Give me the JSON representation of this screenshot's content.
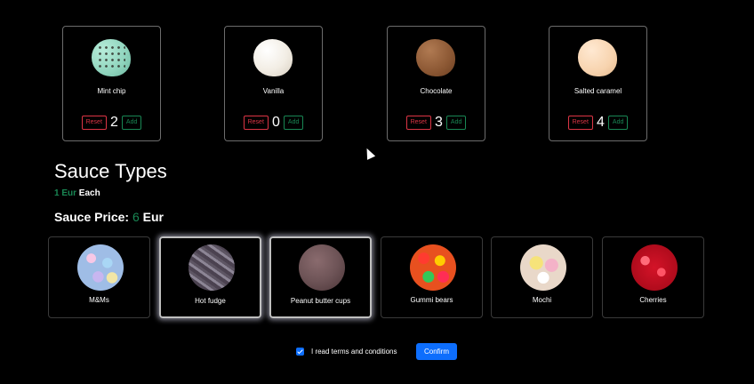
{
  "flavors": [
    {
      "name": "Mint chip",
      "count": "2",
      "reset_label": "Reset",
      "add_label": "Add"
    },
    {
      "name": "Vanilla",
      "count": "0",
      "reset_label": "Reset",
      "add_label": "Add"
    },
    {
      "name": "Chocolate",
      "count": "3",
      "reset_label": "Reset",
      "add_label": "Add"
    },
    {
      "name": "Salted caramel",
      "count": "4",
      "reset_label": "Reset",
      "add_label": "Add"
    }
  ],
  "sauce_section": {
    "title": "Sauce Types",
    "unit_price_value": "1 Eur",
    "unit_price_suffix": "Each",
    "total_label": "Sauce Price:",
    "total_value": "6",
    "total_unit": "Eur"
  },
  "sauces": [
    {
      "name": "M&Ms",
      "selected": false
    },
    {
      "name": "Hot fudge",
      "selected": true
    },
    {
      "name": "Peanut butter cups",
      "selected": true
    },
    {
      "name": "Gummi bears",
      "selected": false
    },
    {
      "name": "Mochi",
      "selected": false
    },
    {
      "name": "Cherries",
      "selected": false
    }
  ],
  "footer": {
    "terms_label": "I read terms and conditions",
    "terms_checked": true,
    "confirm_label": "Confirm"
  },
  "colors": {
    "background": "#000000",
    "reset": "#dc3545",
    "add": "#198754",
    "primary": "#0d6efd",
    "price_accent": "#198754"
  }
}
